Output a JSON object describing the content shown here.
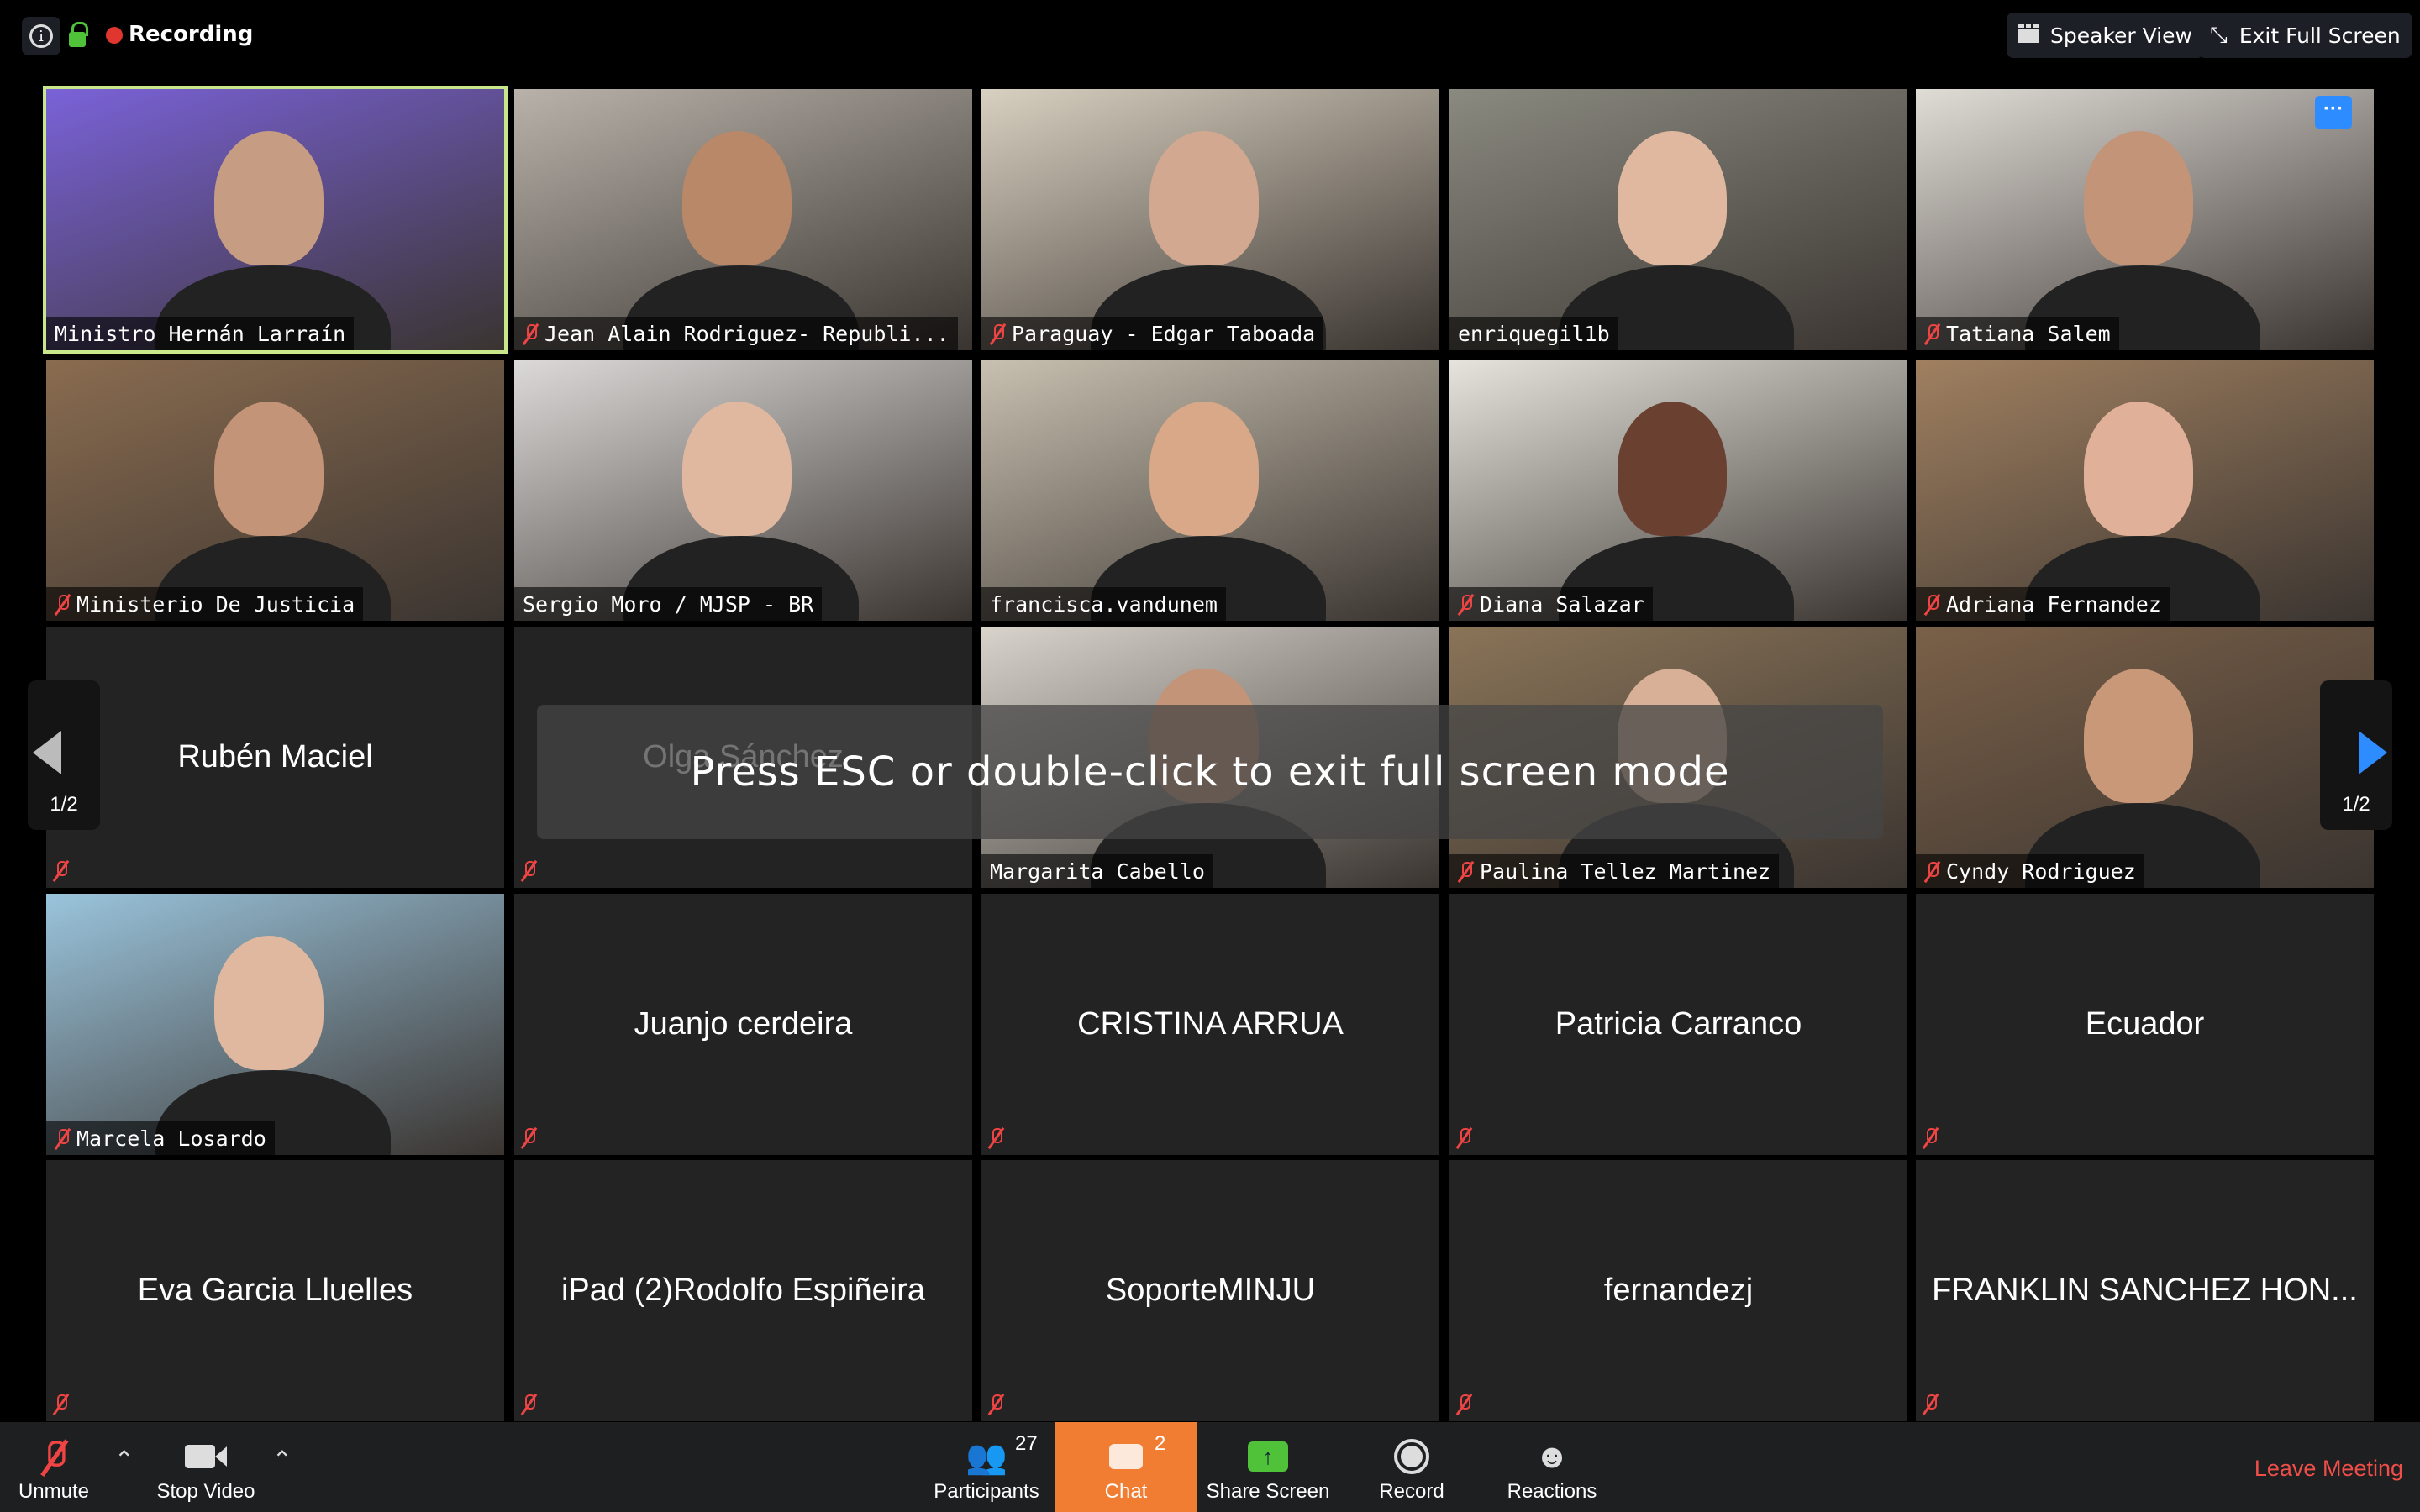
{
  "topbar": {
    "recording_label": "Recording",
    "speaker_view": "Speaker View",
    "exit_full_screen": "Exit Full Screen"
  },
  "overlay": {
    "message": "Press ESC or double-click to exit full screen mode"
  },
  "pagination": {
    "left": "1/2",
    "right": "1/2"
  },
  "colors": {
    "active_border": "#c8e68a",
    "chat_accent": "#f07d31",
    "leave": "#f04e48",
    "share": "#4fc23a",
    "nav_arrow": "#2d8cff"
  },
  "tiles": [
    {
      "name": "Ministro Hernán Larraín",
      "video": true,
      "muted": false,
      "active": true,
      "bg": "#7a62d8",
      "skin": "#c69c82"
    },
    {
      "name": "Jean Alain Rodriguez- Republi...",
      "video": true,
      "muted": true,
      "bg": "#b8b2aa",
      "skin": "#b88868"
    },
    {
      "name": "Paraguay - Edgar Taboada",
      "video": true,
      "muted": true,
      "bg": "#d8d0c0",
      "skin": "#d2a890"
    },
    {
      "name": "enriquegil1b",
      "video": true,
      "muted": false,
      "bg": "#8a8a80",
      "skin": "#e0b8a0"
    },
    {
      "name": "Tatiana Salem",
      "video": true,
      "muted": true,
      "more": true,
      "bg": "#e0dcd6",
      "skin": "#c49478"
    },
    {
      "name": "Ministerio De Justicia",
      "video": true,
      "muted": true,
      "bg": "#8a6c50",
      "skin": "#c49478"
    },
    {
      "name": "Sergio Moro / MJSP - BR",
      "video": true,
      "muted": false,
      "bg": "#dcdad8",
      "skin": "#e0b8a0"
    },
    {
      "name": "francisca.vandunem",
      "video": true,
      "muted": false,
      "bg": "#c8c0b0",
      "skin": "#d8a888"
    },
    {
      "name": "Diana Salazar",
      "video": true,
      "muted": true,
      "bg": "#e6e4dc",
      "skin": "#6a4030"
    },
    {
      "name": "Adriana Fernandez",
      "video": true,
      "muted": true,
      "bg": "#a08060",
      "skin": "#e0b098"
    },
    {
      "name": "Rubén Maciel",
      "video": false,
      "muted": true
    },
    {
      "name": "Olga Sánchez",
      "video": false,
      "muted": true
    },
    {
      "name": "Margarita Cabello",
      "video": true,
      "muted": false,
      "bg": "#d8d4cc",
      "skin": "#c49478"
    },
    {
      "name": "Paulina Tellez Martinez",
      "video": true,
      "muted": true,
      "bg": "#8a7458",
      "skin": "#d8b098"
    },
    {
      "name": "Cyndy Rodriguez",
      "video": true,
      "muted": true,
      "bg": "#7a6048",
      "skin": "#c89878"
    },
    {
      "name": "Marcela Losardo",
      "video": true,
      "muted": true,
      "bg": "#9ac4dc",
      "skin": "#e0b8a0"
    },
    {
      "name": "Juanjo cerdeira",
      "video": false,
      "muted": true
    },
    {
      "name": "CRISTINA ARRUA",
      "video": false,
      "muted": true
    },
    {
      "name": "Patricia Carranco",
      "video": false,
      "muted": true
    },
    {
      "name": "Ecuador",
      "video": false,
      "muted": true
    },
    {
      "name": "Eva Garcia Lluelles",
      "video": false,
      "muted": true
    },
    {
      "name": "iPad (2)Rodolfo Espiñeira",
      "video": false,
      "muted": true
    },
    {
      "name": "SoporteMINJU",
      "video": false,
      "muted": true
    },
    {
      "name": "fernandezj",
      "video": false,
      "muted": true
    },
    {
      "name": "FRANKLIN SANCHEZ HON...",
      "video": false,
      "muted": true
    }
  ],
  "toolbar": {
    "unmute": "Unmute",
    "stop_video": "Stop Video",
    "participants": "Participants",
    "participants_count": "27",
    "chat": "Chat",
    "chat_count": "2",
    "share_screen": "Share Screen",
    "record": "Record",
    "reactions": "Reactions",
    "leave": "Leave Meeting"
  }
}
